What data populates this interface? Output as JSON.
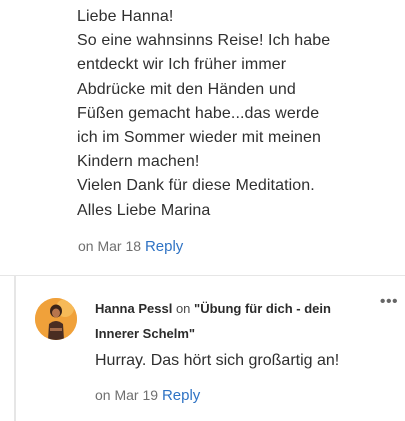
{
  "first_comment": {
    "body": "Liebe Hanna!\nSo eine wahnsinns Reise! Ich habe\nentdeckt wir Ich früher immer\nAbdrücke mit den Händen und\nFüßen gemacht habe...das werde\nich im Sommer wieder mit meinen\nKindern machen!\nVielen Dank für diese Meditation.\nAlles Liebe Marina",
    "on_label": "on",
    "date": "Mar 18",
    "reply_label": "Reply"
  },
  "reply_comment": {
    "author": "Hanna Pessl",
    "on_label": "on",
    "post_title": "\"Übung für dich - dein Innerer Schelm\"",
    "more_icon": "more-horizontal-icon",
    "more_label": "•••",
    "body": "Hurray. Das hört sich großartig an!",
    "date_on_label": "on",
    "date": "Mar 19",
    "reply_label": "Reply"
  },
  "colors": {
    "link": "#2f73c4",
    "meta_text": "#6f6f6f",
    "body_text": "#2f2f2f",
    "divider": "#e6e6e6",
    "avatar_bg": "#f0a13a"
  }
}
